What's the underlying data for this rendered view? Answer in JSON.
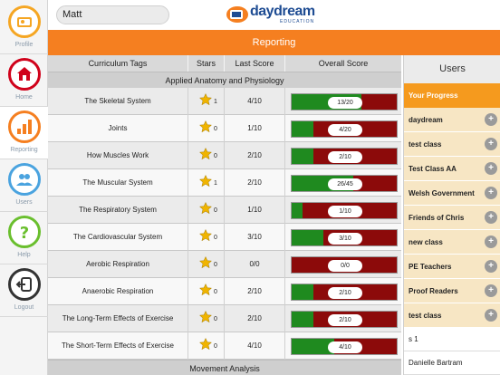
{
  "search": {
    "value": "Matt"
  },
  "logo": {
    "word": "daydream",
    "sub": "EDUCATION"
  },
  "nav": [
    {
      "label": "Profile",
      "icon": "profile-card-icon",
      "color": "#f5a623"
    },
    {
      "label": "Home",
      "icon": "home-icon",
      "color": "#d0021b"
    },
    {
      "label": "Reporting",
      "icon": "bar-chart-icon",
      "color": "#f57f20"
    },
    {
      "label": "Users",
      "icon": "users-icon",
      "color": "#4aa3df"
    },
    {
      "label": "Help",
      "icon": "question-icon",
      "color": "#6abf2e"
    },
    {
      "label": "Logout",
      "icon": "logout-icon",
      "color": "#333333"
    }
  ],
  "banner": {
    "title": "Reporting"
  },
  "table": {
    "headers": [
      "Curriculum Tags",
      "Stars",
      "Last Score",
      "Overall Score"
    ],
    "sections": [
      {
        "title": "Applied Anatomy and Physiology",
        "rows": [
          {
            "tag": "The Skeletal System",
            "stars": "1",
            "last": "4/10",
            "overall": "13/20",
            "correct": 13,
            "total": 20
          },
          {
            "tag": "Joints",
            "stars": "0",
            "last": "1/10",
            "overall": "4/20",
            "correct": 4,
            "total": 20
          },
          {
            "tag": "How Muscles Work",
            "stars": "0",
            "last": "2/10",
            "overall": "2/10",
            "correct": 2,
            "total": 10
          },
          {
            "tag": "The Muscular System",
            "stars": "1",
            "last": "2/10",
            "overall": "26/45",
            "correct": 26,
            "total": 45
          },
          {
            "tag": "The Respiratory System",
            "stars": "0",
            "last": "1/10",
            "overall": "1/10",
            "correct": 1,
            "total": 10
          },
          {
            "tag": "The Cardiovascular System",
            "stars": "0",
            "last": "3/10",
            "overall": "3/10",
            "correct": 3,
            "total": 10
          },
          {
            "tag": "Aerobic Respiration",
            "stars": "0",
            "last": "0/0",
            "overall": "0/0",
            "correct": 0,
            "total": 0
          },
          {
            "tag": "Anaerobic Respiration",
            "stars": "0",
            "last": "2/10",
            "overall": "2/10",
            "correct": 2,
            "total": 10
          },
          {
            "tag": "The Long-Term Effects of Exercise",
            "stars": "0",
            "last": "2/10",
            "overall": "2/10",
            "correct": 2,
            "total": 10
          },
          {
            "tag": "The Short-Term Effects of Exercise",
            "stars": "0",
            "last": "4/10",
            "overall": "4/10",
            "correct": 4,
            "total": 10
          }
        ]
      },
      {
        "title": "Movement Analysis",
        "rows": []
      }
    ]
  },
  "users": {
    "title": "Users",
    "progress_label": "Your Progress",
    "groups": [
      "daydream",
      "test class",
      "Test Class AA",
      "Welsh Government",
      "Friends of Chris",
      "new class",
      "PE Teachers",
      "Proof Readers",
      "test class"
    ],
    "people": [
      "s 1",
      "Danielle Bartram"
    ]
  },
  "colors": {
    "accent": "#f57f20",
    "progress_good": "#1f8a1f",
    "progress_bad": "#8c0a0a",
    "users_highlight": "#f59a1e"
  }
}
